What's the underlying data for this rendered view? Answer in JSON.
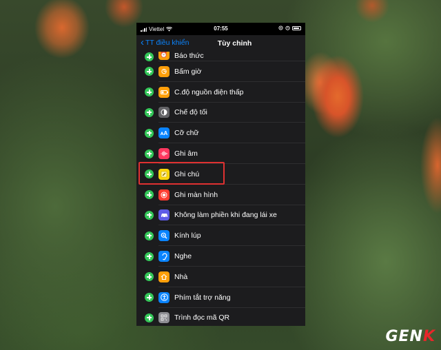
{
  "status_bar": {
    "carrier": "Viettel",
    "time": "07:55"
  },
  "nav": {
    "back_label": "TT điều khiển",
    "title": "Tùy chỉnh"
  },
  "items": [
    {
      "label": "Báo thức",
      "icon": "alarm-icon",
      "color": "#ff9f0a"
    },
    {
      "label": "Bấm giờ",
      "icon": "stopwatch-icon",
      "color": "#ff9f0a"
    },
    {
      "label": "C.độ nguồn điện thấp",
      "icon": "low-power-icon",
      "color": "#ff9f0a"
    },
    {
      "label": "Chế độ tối",
      "icon": "dark-mode-icon",
      "color": "#636366"
    },
    {
      "label": "Cỡ chữ",
      "icon": "text-size-icon",
      "color": "#0a84ff"
    },
    {
      "label": "Ghi âm",
      "icon": "voice-memo-icon",
      "color": "#ff375f"
    },
    {
      "label": "Ghi chú",
      "icon": "notes-icon",
      "color": "#ffd60a"
    },
    {
      "label": "Ghi màn hình",
      "icon": "screen-record-icon",
      "color": "#ff3b30"
    },
    {
      "label": "Không làm phiền khi đang lái xe",
      "icon": "car-icon",
      "color": "#5e5ce6"
    },
    {
      "label": "Kính lúp",
      "icon": "magnifier-icon",
      "color": "#0a84ff"
    },
    {
      "label": "Nghe",
      "icon": "ear-icon",
      "color": "#0a84ff"
    },
    {
      "label": "Nhà",
      "icon": "home-icon",
      "color": "#ff9f0a"
    },
    {
      "label": "Phím tắt trợ năng",
      "icon": "accessibility-icon",
      "color": "#0a84ff"
    },
    {
      "label": "Trình đọc mã QR",
      "icon": "qr-code-icon",
      "color": "#8e8e93"
    }
  ],
  "watermark": {
    "part1": "GEN",
    "part2": "K"
  },
  "colors": {
    "accent": "#0a84ff",
    "add": "#34c759",
    "highlight": "#e03131"
  }
}
